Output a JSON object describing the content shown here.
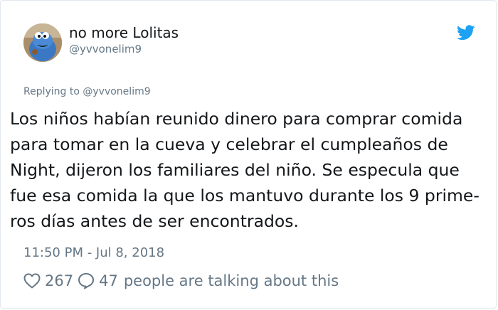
{
  "user": {
    "display_name": "no more Lolitas",
    "handle": "@yvvonelim9"
  },
  "reply": {
    "prefix": "Replying to",
    "mention": "@yvvonelim9"
  },
  "tweet": {
    "lines": [
      "Los niños habían reunido dinero para comprar comida",
      "para tomar en la cueva y celebrar el cumpleaños de",
      "Night, dijeron los familiares del niño. Se especula que",
      "fue esa comida la que los mantuvo durante los 9 prime-",
      "ros días antes de ser encontrados."
    ]
  },
  "timestamp": "11:50 PM - Jul 8, 2018",
  "actions": {
    "likes": "267",
    "replies": "47",
    "talking_label": "people are talking about this"
  },
  "icons": {
    "brand": "twitter-bird-icon",
    "like": "heart-icon",
    "reply": "speech-bubble-icon"
  },
  "colors": {
    "brand_blue": "#1da1f2",
    "text": "#14171a",
    "muted": "#657786",
    "border": "#e1e8ed"
  }
}
